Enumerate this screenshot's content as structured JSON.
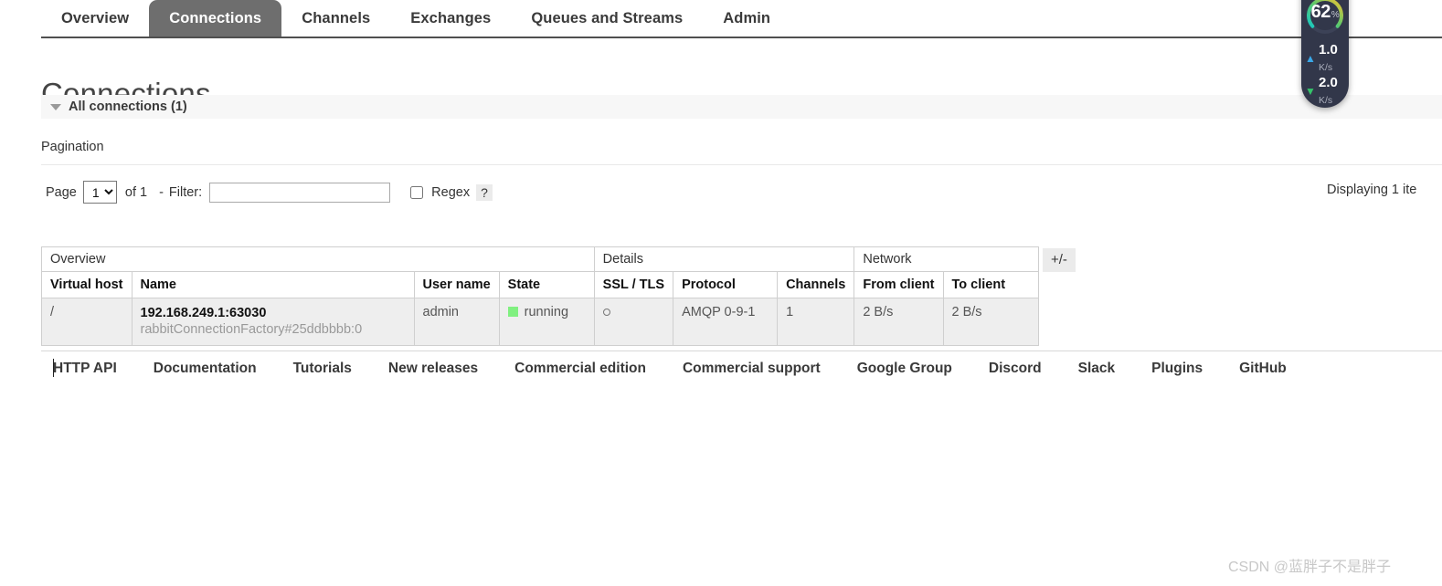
{
  "nav": {
    "tabs": [
      {
        "label": "Overview",
        "active": false
      },
      {
        "label": "Connections",
        "active": true
      },
      {
        "label": "Channels",
        "active": false
      },
      {
        "label": "Exchanges",
        "active": false
      },
      {
        "label": "Queues and Streams",
        "active": false
      },
      {
        "label": "Admin",
        "active": false
      }
    ]
  },
  "page": {
    "title": "Connections",
    "section_label": "All connections (1)"
  },
  "pagination": {
    "title": "Pagination",
    "page_word": "Page",
    "page_value": "1",
    "page_options": [
      "1"
    ],
    "of_text": "of 1",
    "dash": "-",
    "filter_label": "Filter:",
    "filter_value": "",
    "filter_placeholder": "",
    "regex_label": "Regex",
    "regex_help": "?",
    "regex_checked": false,
    "displaying": "Displaying 1 ite"
  },
  "table": {
    "group_headers": [
      {
        "label": "Overview",
        "colspan": 4
      },
      {
        "label": "Details",
        "colspan": 3
      },
      {
        "label": "Network",
        "colspan": 2
      }
    ],
    "columns": [
      "Virtual host",
      "Name",
      "User name",
      "State",
      "SSL / TLS",
      "Protocol",
      "Channels",
      "From client",
      "To client"
    ],
    "rows": [
      {
        "virtual_host": "/",
        "name": "192.168.249.1:63030",
        "name_sub": "rabbitConnectionFactory#25ddbbbb:0",
        "user_name": "admin",
        "state": "running",
        "state_color": "#80f080",
        "ssl_tls": "○",
        "protocol": "AMQP 0-9-1",
        "channels": "1",
        "from_client": "2 B/s",
        "to_client": "2 B/s"
      }
    ],
    "toggle_columns_label": "+/-"
  },
  "footer": {
    "links": [
      "HTTP API",
      "Documentation",
      "Tutorials",
      "New releases",
      "Commercial edition",
      "Commercial support",
      "Google Group",
      "Discord",
      "Slack",
      "Plugins",
      "GitHub"
    ]
  },
  "system_monitor": {
    "cpu_value": "62",
    "cpu_unit": "%",
    "upload_value": "1.0",
    "upload_unit": "K/s",
    "upload_arrow": "▲",
    "download_value": "2.0",
    "download_unit": "K/s",
    "download_arrow": "▼",
    "gauge_color_start": "#f2c230",
    "gauge_color_mid": "#5fc96a",
    "gauge_color_end": "#19c8c0",
    "background_color": "#32374a"
  },
  "watermark": {
    "text": "CSDN @蓝胖子不是胖子"
  }
}
